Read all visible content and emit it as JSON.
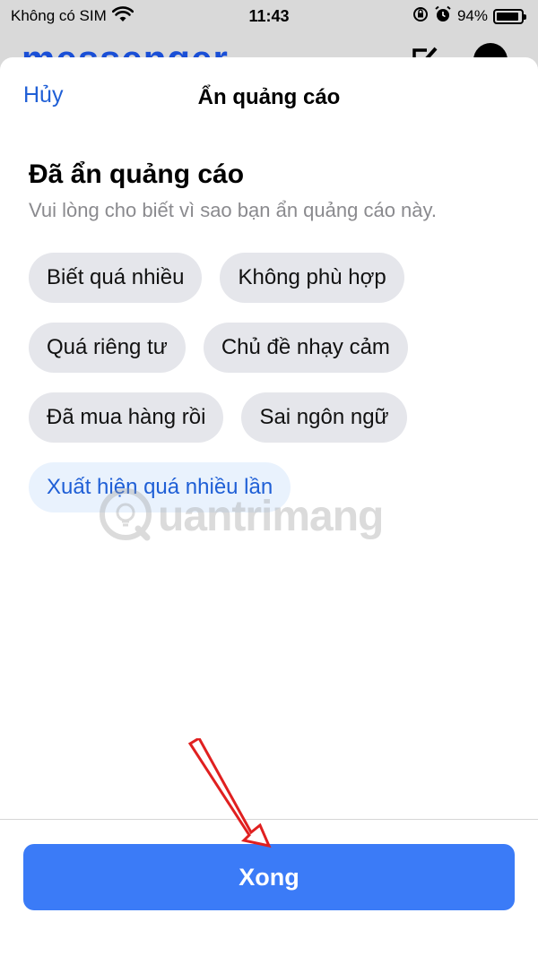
{
  "status_bar": {
    "carrier": "Không có SIM",
    "time": "11:43",
    "battery": "94%",
    "battery_level": 0.94,
    "icons": [
      "wifi-icon",
      "orientation-lock-icon",
      "alarm-icon",
      "battery-icon"
    ]
  },
  "background_app": {
    "logo": "messenger",
    "icons": [
      "compose-icon",
      "facebook-icon"
    ],
    "accent": "#1a4fd6"
  },
  "sheet": {
    "cancel_label": "Hủy",
    "title": "Ẩn quảng cáo",
    "heading": "Đã ẩn quảng cáo",
    "subtext": "Vui lòng cho biết vì sao bạn ẩn quảng cáo này.",
    "reasons": [
      {
        "label": "Biết quá nhiều",
        "selected": false
      },
      {
        "label": "Không phù hợp",
        "selected": false
      },
      {
        "label": "Quá riêng tư",
        "selected": false
      },
      {
        "label": "Chủ đề nhạy cảm",
        "selected": false
      },
      {
        "label": "Đã mua hàng rồi",
        "selected": false
      },
      {
        "label": "Sai ngôn ngữ",
        "selected": false
      },
      {
        "label": "Xuất hiện quá nhiều lần",
        "selected": true
      }
    ],
    "done_label": "Xong"
  },
  "watermark": {
    "text": "uantrimang",
    "icon": "quantrimang-logo-icon"
  },
  "annotation": {
    "icon": "red-arrow-icon",
    "color": "#e02020"
  },
  "colors": {
    "primary_button": "#3b7bf7",
    "link": "#1f5fd6",
    "chip_bg": "#e5e6eb",
    "chip_selected_bg": "#e9f2fd"
  }
}
